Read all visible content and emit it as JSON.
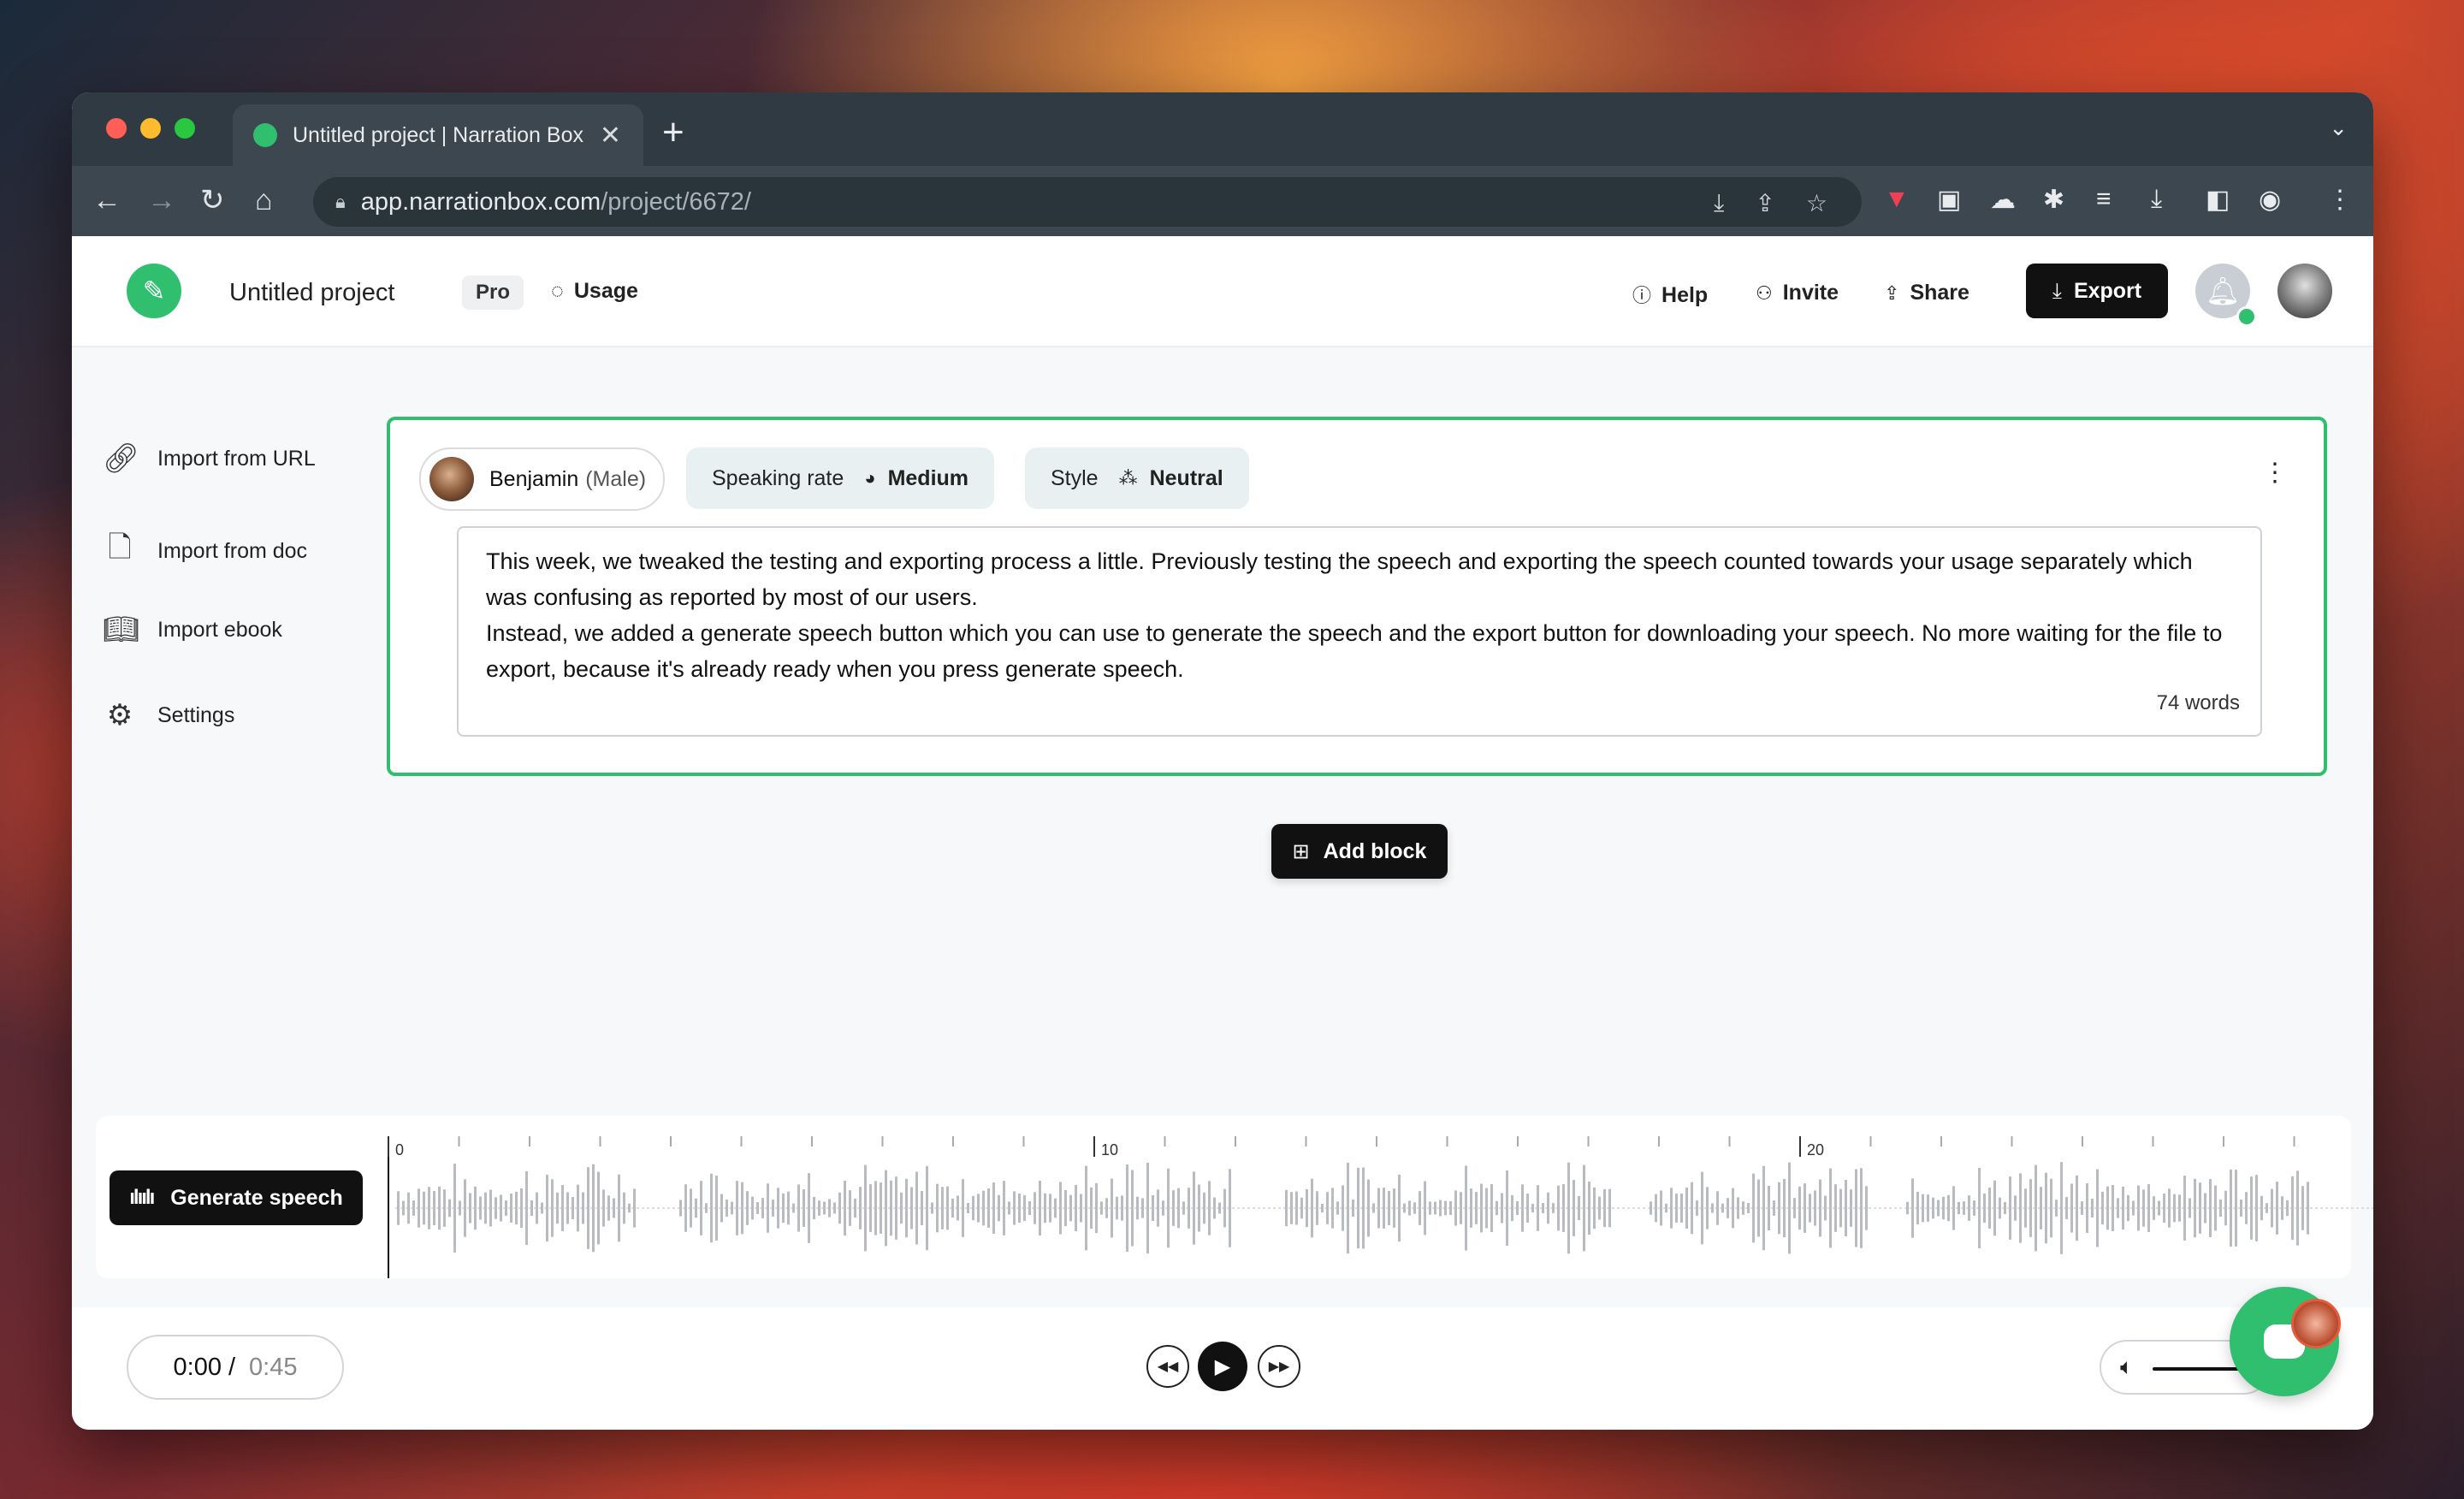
{
  "browser": {
    "tab_title": "Untitled project | Narration Box",
    "tab_close": "✕",
    "new_tab": "+",
    "url_domain": "app.narrationbox.com",
    "url_path": "/project/6672/"
  },
  "header": {
    "project_title": "Untitled project",
    "plan_badge": "Pro",
    "usage_label": "Usage",
    "help_label": "Help",
    "invite_label": "Invite",
    "share_label": "Share",
    "export_label": "Export"
  },
  "sidebar": {
    "items": [
      {
        "label": "Import from URL",
        "icon": "link-icon"
      },
      {
        "label": "Import from doc",
        "icon": "document-icon"
      },
      {
        "label": "Import ebook",
        "icon": "book-icon"
      },
      {
        "label": "Settings",
        "icon": "gear-icon"
      }
    ]
  },
  "block": {
    "voice_name": "Benjamin",
    "voice_gender": "(Male)",
    "speaking_rate_label": "Speaking rate",
    "speaking_rate_value": "Medium",
    "style_label": "Style",
    "style_value": "Neutral",
    "text_para1": "This week, we tweaked the testing and exporting process a little. Previously testing the speech and exporting the speech counted towards your usage separately which was confusing as reported by most of our users.",
    "text_para2": "Instead, we added a generate speech button which you can use to generate the speech and the export button for downloading your speech. No more waiting for the file to export, because it's already ready when you press generate speech.",
    "word_count": "74 words"
  },
  "add_block_label": "Add block",
  "timeline": {
    "generate_label": "Generate speech",
    "ticks": [
      "0",
      "10",
      "20"
    ]
  },
  "player": {
    "current_time": "0:00",
    "separator": "/",
    "total_time": "0:45"
  },
  "colors": {
    "accent": "#2fbf6f",
    "primary_button": "#111111",
    "chrome_dark": "#2f3a42"
  }
}
